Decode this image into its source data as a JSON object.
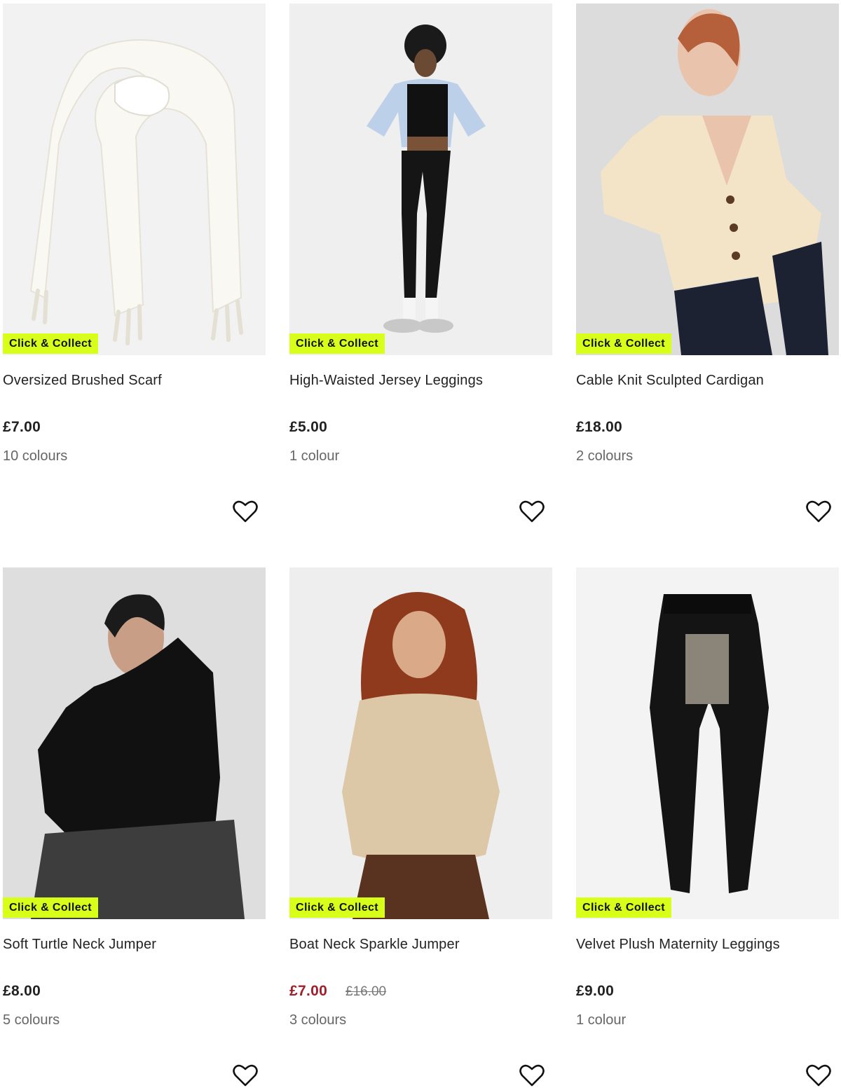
{
  "badge_color": "#d8ff1a",
  "sale_color": "#a01f2a",
  "products": [
    {
      "name": "Oversized Brushed Scarf",
      "price": "£7.00",
      "colours": "10 colours",
      "badge": "Click & Collect",
      "image": "cream-scarf-image",
      "icon": "heart-icon"
    },
    {
      "name": "High-Waisted Jersey Leggings",
      "price": "£5.00",
      "colours": "1 colour",
      "badge": "Click & Collect",
      "image": "black-leggings-model-image",
      "icon": "heart-icon"
    },
    {
      "name": "Cable Knit Sculpted Cardigan",
      "price": "£18.00",
      "colours": "2 colours",
      "badge": "Click & Collect",
      "image": "cream-cardigan-model-image",
      "icon": "heart-icon"
    },
    {
      "name": "Soft Turtle Neck Jumper",
      "price": "£8.00",
      "colours": "5 colours",
      "badge": "Click & Collect",
      "image": "black-turtleneck-model-image",
      "icon": "heart-icon"
    },
    {
      "name": "Boat Neck Sparkle Jumper",
      "price": "£7.00",
      "was_price": "£16.00",
      "colours": "3 colours",
      "badge": "Click & Collect",
      "image": "beige-jumper-model-image",
      "icon": "heart-icon"
    },
    {
      "name": "Velvet Plush Maternity Leggings",
      "price": "£9.00",
      "colours": "1 colour",
      "badge": "Click & Collect",
      "image": "black-maternity-leggings-image",
      "icon": "heart-icon"
    }
  ]
}
